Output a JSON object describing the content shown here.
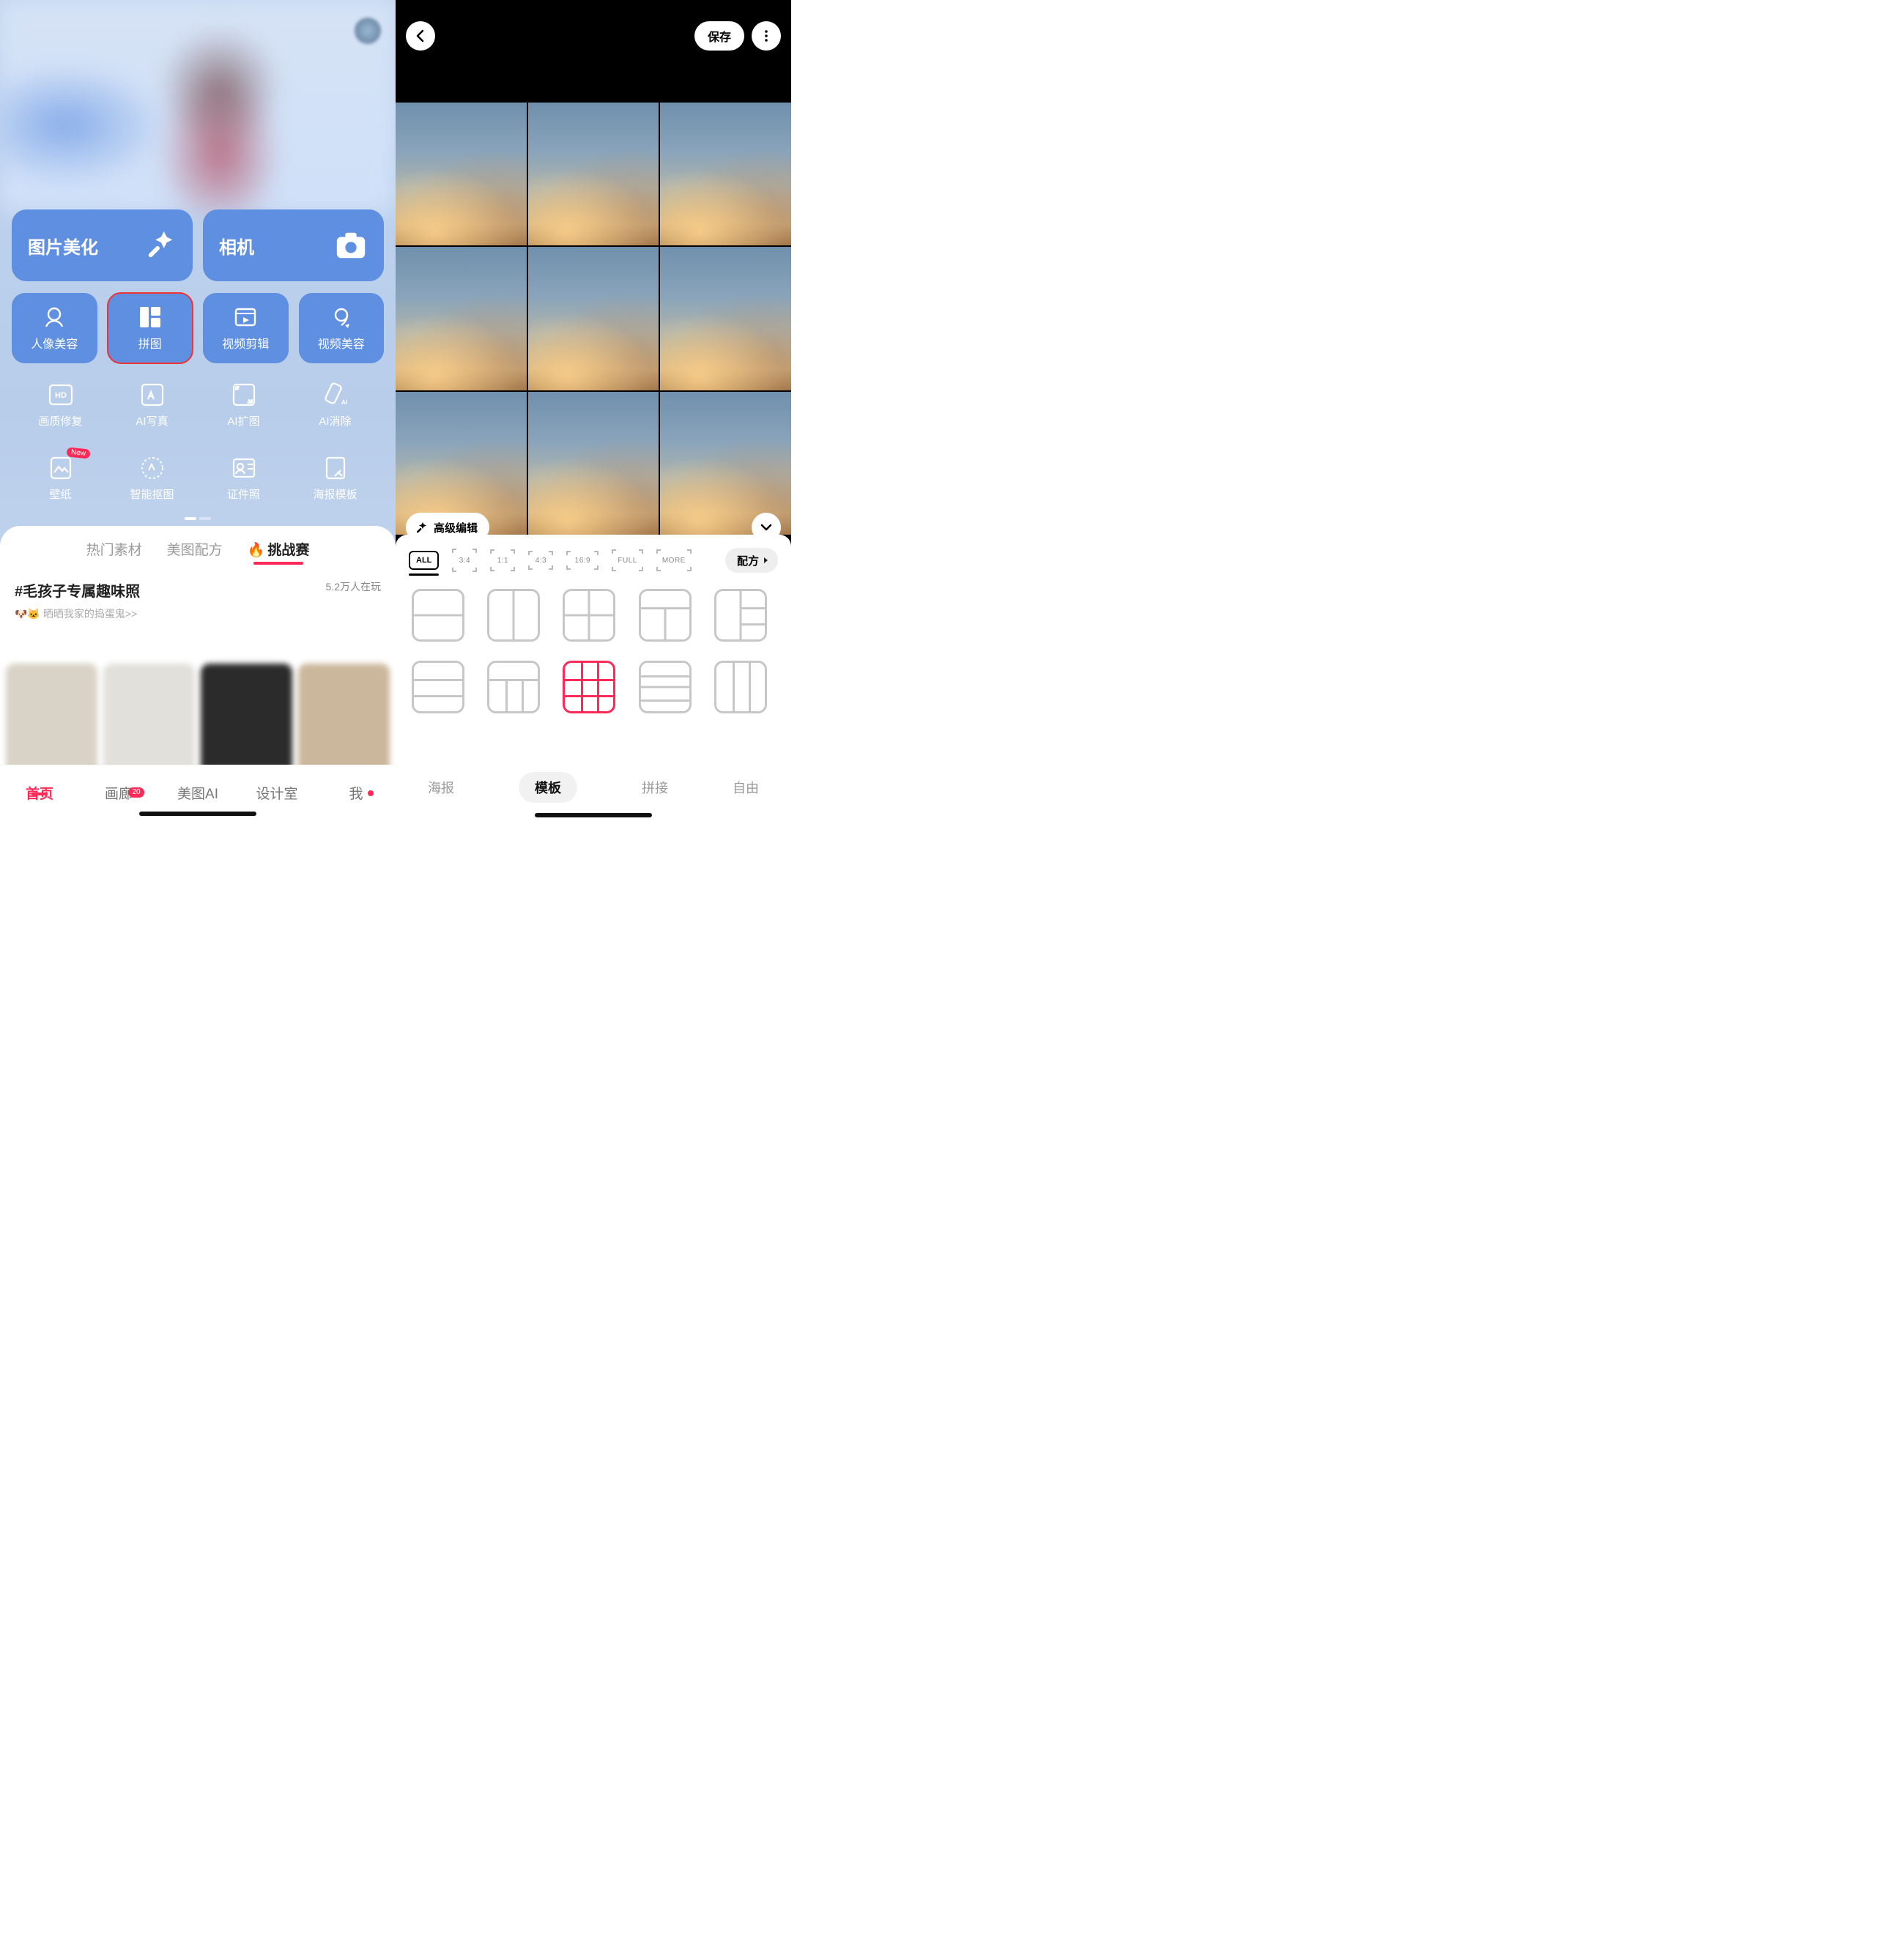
{
  "home": {
    "bigButtons": {
      "beautify": "图片美化",
      "camera": "相机"
    },
    "toolRow": [
      {
        "label": "人像美容",
        "icon": "face-icon"
      },
      {
        "label": "拼图",
        "icon": "collage-icon",
        "highlight": true
      },
      {
        "label": "视频剪辑",
        "icon": "video-edit-icon"
      },
      {
        "label": "视频美容",
        "icon": "video-beauty-icon"
      }
    ],
    "miniRow2": [
      {
        "label": "画质修复",
        "icon": "hd-icon"
      },
      {
        "label": "AI写真",
        "icon": "ai-portrait-icon"
      },
      {
        "label": "AI扩图",
        "icon": "ai-expand-icon"
      },
      {
        "label": "AI消除",
        "icon": "ai-erase-icon"
      }
    ],
    "miniRow3": [
      {
        "label": "壁纸",
        "icon": "wallpaper-icon",
        "badge": "New"
      },
      {
        "label": "智能抠图",
        "icon": "cutout-icon"
      },
      {
        "label": "证件照",
        "icon": "id-photo-icon"
      },
      {
        "label": "海报模板",
        "icon": "poster-icon"
      }
    ],
    "tabs": {
      "t1": "热门素材",
      "t2": "美图配方",
      "t3": "挑战赛",
      "fire": "🔥"
    },
    "topic": {
      "title": "#毛孩子专属趣味照",
      "count": "5.2万人在玩",
      "sub": "晒晒我家的捣蛋鬼>>",
      "emoji": "🐶🐱"
    },
    "bottomNav": {
      "home": "首页",
      "gallery": "画廊",
      "galleryBadge": "20",
      "ai": "美图AI",
      "studio": "设计室",
      "me": "我"
    }
  },
  "editor": {
    "save": "保存",
    "advanced": "高级编辑",
    "ratios": {
      "all": "ALL",
      "r34": "3:4",
      "r11": "1:1",
      "r43": "4:3",
      "r169": "16:9",
      "full": "FULL",
      "more": "MORE"
    },
    "recipe": "配方",
    "modes": {
      "poster": "海报",
      "template": "模板",
      "stitch": "拼接",
      "free": "自由"
    }
  }
}
